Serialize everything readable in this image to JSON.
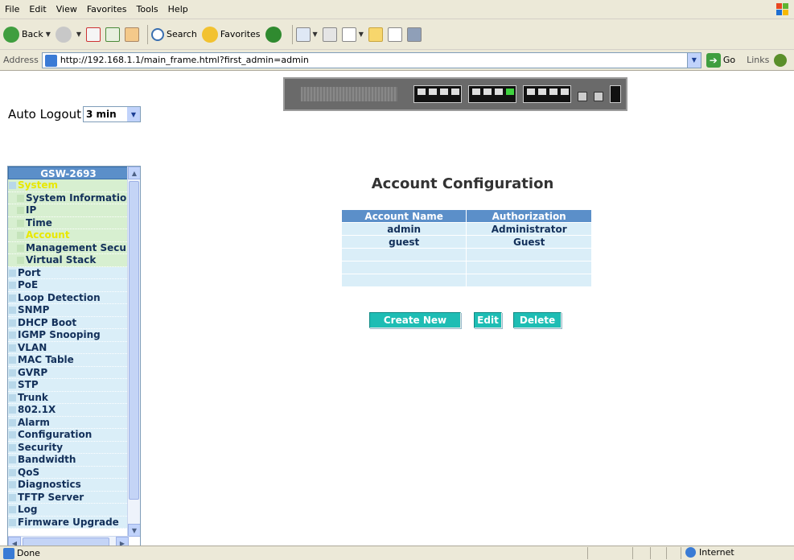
{
  "menu": [
    "File",
    "Edit",
    "View",
    "Favorites",
    "Tools",
    "Help"
  ],
  "toolbar": {
    "back": "Back",
    "search": "Search",
    "favorites": "Favorites"
  },
  "address": {
    "label": "Address",
    "url": "http://192.168.1.1/main_frame.html?first_admin=admin",
    "go": "Go",
    "links": "Links"
  },
  "autologout": {
    "label": "Auto Logout",
    "value": "3 min"
  },
  "sidebar": {
    "title": "GSW-2693",
    "items": [
      {
        "label": "System",
        "level": 0,
        "state": "open"
      },
      {
        "label": "System Information",
        "level": 1
      },
      {
        "label": "IP",
        "level": 1
      },
      {
        "label": "Time",
        "level": 1
      },
      {
        "label": "Account",
        "level": 1,
        "state": "selected"
      },
      {
        "label": "Management Security",
        "level": 1
      },
      {
        "label": "Virtual Stack",
        "level": 1
      },
      {
        "label": "Port",
        "level": 0
      },
      {
        "label": "PoE",
        "level": 0
      },
      {
        "label": "Loop Detection",
        "level": 0
      },
      {
        "label": "SNMP",
        "level": 0
      },
      {
        "label": "DHCP Boot",
        "level": 0
      },
      {
        "label": "IGMP Snooping",
        "level": 0
      },
      {
        "label": "VLAN",
        "level": 0
      },
      {
        "label": "MAC Table",
        "level": 0
      },
      {
        "label": "GVRP",
        "level": 0
      },
      {
        "label": "STP",
        "level": 0
      },
      {
        "label": "Trunk",
        "level": 0
      },
      {
        "label": "802.1X",
        "level": 0
      },
      {
        "label": "Alarm",
        "level": 0
      },
      {
        "label": "Configuration",
        "level": 0
      },
      {
        "label": "Security",
        "level": 0
      },
      {
        "label": "Bandwidth",
        "level": 0
      },
      {
        "label": "QoS",
        "level": 0
      },
      {
        "label": "Diagnostics",
        "level": 0
      },
      {
        "label": "TFTP Server",
        "level": 0
      },
      {
        "label": "Log",
        "level": 0
      },
      {
        "label": "Firmware Upgrade",
        "level": 0
      }
    ]
  },
  "main": {
    "title": "Account Configuration",
    "table": {
      "headers": [
        "Account Name",
        "Authorization"
      ],
      "rows": [
        [
          "admin",
          "Administrator"
        ],
        [
          "guest",
          "Guest"
        ],
        [
          "",
          ""
        ],
        [
          "",
          ""
        ],
        [
          "",
          ""
        ]
      ]
    },
    "buttons": {
      "create": "Create New",
      "edit": "Edit",
      "delete": "Delete"
    }
  },
  "status": {
    "text": "Done",
    "zone": "Internet"
  },
  "colors": {
    "header_blue": "#5b8fc9",
    "row_blue": "#daeef8",
    "button_teal": "#1ebdb4",
    "selected_yellow": "#e8e800"
  }
}
